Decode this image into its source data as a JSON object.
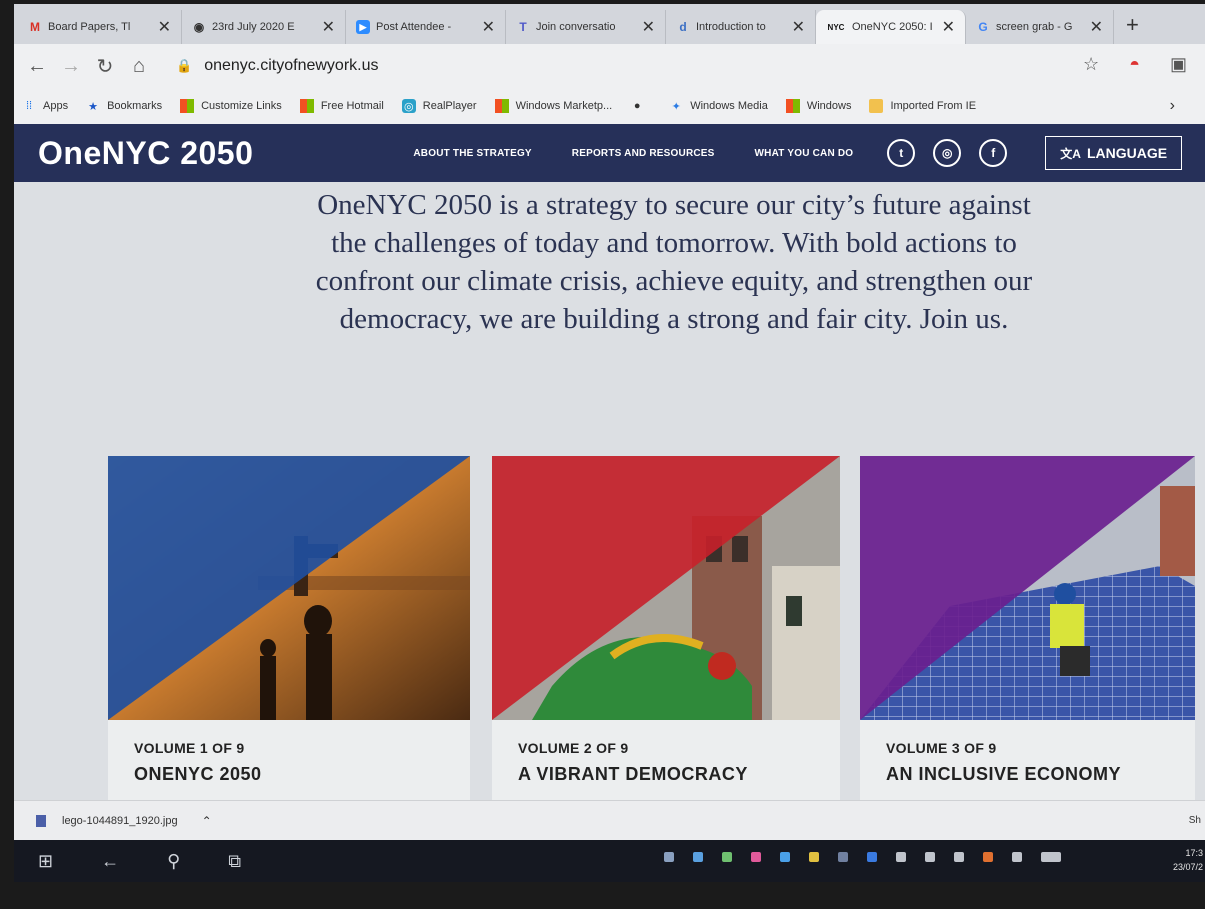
{
  "browser": {
    "tabs": [
      {
        "title": "Board Papers, Tl",
        "favicon": "gmail-icon",
        "color": "#d93025"
      },
      {
        "title": "23rd July 2020 E",
        "favicon": "globe-icon",
        "color": "#333333"
      },
      {
        "title": "Post Attendee -",
        "favicon": "zoom-icon",
        "color": "#2d8cff"
      },
      {
        "title": "Join conversatio",
        "favicon": "teams-icon",
        "color": "#5059c9"
      },
      {
        "title": "Introduction to",
        "favicon": "doc-icon",
        "color": "#3b6fc4"
      },
      {
        "title": "OneNYC 2050: I",
        "favicon": "nyc-icon",
        "color": "#111111"
      },
      {
        "title": "screen grab - G",
        "favicon": "google-icon",
        "color": "#4285f4"
      }
    ],
    "new_tab": "+",
    "close_glyph": "✕",
    "url": "onenyc.cityofnewyork.us",
    "bookmarks": [
      {
        "label": "Apps",
        "icon": "apps-grid-icon"
      },
      {
        "label": "Bookmarks",
        "icon": "star-icon"
      },
      {
        "label": "Customize Links",
        "icon": "ms-icon"
      },
      {
        "label": "Free Hotmail",
        "icon": "ms-icon"
      },
      {
        "label": "RealPlayer",
        "icon": "realplayer-icon"
      },
      {
        "label": "Windows Marketp...",
        "icon": "ms-icon"
      },
      {
        "label": "",
        "icon": "github-icon"
      },
      {
        "label": "Windows Media",
        "icon": "media-icon"
      },
      {
        "label": "Windows",
        "icon": "ms-icon"
      },
      {
        "label": "Imported From IE",
        "icon": "folder-icon"
      }
    ]
  },
  "site": {
    "logo": "OneNYC 2050",
    "nav": [
      "ABOUT THE STRATEGY",
      "REPORTS AND RESOURCES",
      "WHAT YOU CAN DO"
    ],
    "social": [
      {
        "name": "twitter",
        "glyph": "t"
      },
      {
        "name": "instagram",
        "glyph": "◎"
      },
      {
        "name": "facebook",
        "glyph": "f"
      }
    ],
    "language_button": "LANGUAGE",
    "hero_text": "OneNYC 2050 is a strategy to secure our city’s future against the challenges of today and tomorrow. With bold actions to confront our climate crisis, achieve equity, and strengthen our democracy, we are building a strong and fair city. Join us.",
    "cards": [
      {
        "volume": "VOLUME 1 OF 9",
        "title": "ONENYC 2050",
        "accent": "#1f4fa0"
      },
      {
        "volume": "VOLUME 2 OF 9",
        "title": "A VIBRANT DEMOCRACY",
        "accent": "#c8202a"
      },
      {
        "volume": "VOLUME 3 OF 9",
        "title": "AN INCLUSIVE ECONOMY",
        "accent": "#6a1f8f"
      }
    ]
  },
  "download_bar": {
    "filename": "lego-1044891_1920.jpg",
    "show_all": "Sh"
  },
  "taskbar": {
    "time": "17:3",
    "date": "23/07/2"
  }
}
